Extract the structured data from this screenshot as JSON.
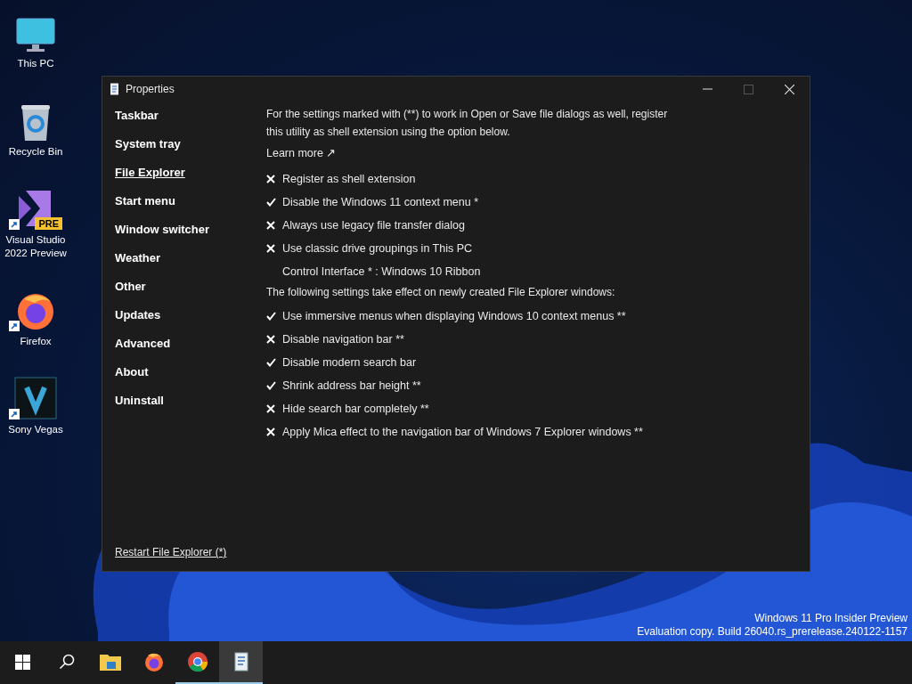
{
  "desktop_icons": [
    {
      "kind": "monitor",
      "label": "This PC",
      "shortcut": false
    },
    {
      "kind": "recycle",
      "label": "Recycle Bin",
      "shortcut": false
    },
    {
      "kind": "vs",
      "label": "Visual Studio 2022 Preview",
      "badge": "PRE",
      "shortcut": true
    },
    {
      "kind": "firefox",
      "label": "Firefox",
      "shortcut": true
    },
    {
      "kind": "vegas",
      "label": "Sony Vegas",
      "shortcut": true
    }
  ],
  "window": {
    "title": "Properties",
    "controls": [
      {
        "kind": "minimize",
        "disabled": false
      },
      {
        "kind": "maximize",
        "disabled": true
      },
      {
        "kind": "close",
        "disabled": false
      }
    ],
    "sidebar": {
      "items": [
        {
          "label": "Taskbar",
          "selected": false
        },
        {
          "label": "System tray",
          "selected": false
        },
        {
          "label": "File Explorer",
          "selected": true
        },
        {
          "label": "Start menu",
          "selected": false
        },
        {
          "label": "Window switcher",
          "selected": false
        },
        {
          "label": "Weather",
          "selected": false
        },
        {
          "label": "Other",
          "selected": false
        },
        {
          "label": "Updates",
          "selected": false
        },
        {
          "label": "Advanced",
          "selected": false
        },
        {
          "label": "About",
          "selected": false
        },
        {
          "label": "Uninstall",
          "selected": false
        }
      ],
      "footer_link": "Restart File Explorer (*)"
    },
    "content": [
      {
        "kind": "note",
        "text": "For the settings marked with (**) to work in Open or Save file dialogs as well, register this utility as shell extension using the option below."
      },
      {
        "kind": "link",
        "text": "Learn more ↗"
      },
      {
        "kind": "toggle",
        "text": "Register as shell extension",
        "checked": false
      },
      {
        "kind": "toggle",
        "text": "Disable the Windows 11 context menu *",
        "checked": true
      },
      {
        "kind": "toggle",
        "text": "Always use legacy file transfer dialog",
        "checked": false
      },
      {
        "kind": "toggle",
        "text": "Use classic drive groupings in This PC",
        "checked": false
      },
      {
        "kind": "choice",
        "text": "Control Interface * : Windows 10 Ribbon"
      },
      {
        "kind": "note",
        "text": "The following settings take effect on newly created File Explorer windows:"
      },
      {
        "kind": "toggle",
        "text": "Use immersive menus when displaying Windows 10 context menus **",
        "checked": true
      },
      {
        "kind": "toggle",
        "text": "Disable navigation bar **",
        "checked": false
      },
      {
        "kind": "toggle",
        "text": "Disable modern search bar",
        "checked": true
      },
      {
        "kind": "toggle",
        "text": "Shrink address bar height **",
        "checked": true
      },
      {
        "kind": "toggle",
        "text": "Hide search bar completely **",
        "checked": false
      },
      {
        "kind": "toggle",
        "text": "Apply Mica effect to the navigation bar of Windows 7 Explorer windows **",
        "checked": false
      }
    ]
  },
  "watermark_lines": [
    "Windows 11 Pro Insider Preview",
    "Evaluation copy. Build 26040.rs_prerelease.240122-1157"
  ],
  "taskbar": {
    "items": [
      {
        "kind": "start",
        "running": false,
        "selected": false
      },
      {
        "kind": "search",
        "running": false,
        "selected": false
      },
      {
        "kind": "folder",
        "running": false,
        "selected": false
      },
      {
        "kind": "firefox",
        "running": false,
        "selected": false
      },
      {
        "kind": "chrome",
        "running": true,
        "selected": false
      },
      {
        "kind": "app",
        "running": true,
        "selected": true
      }
    ]
  }
}
